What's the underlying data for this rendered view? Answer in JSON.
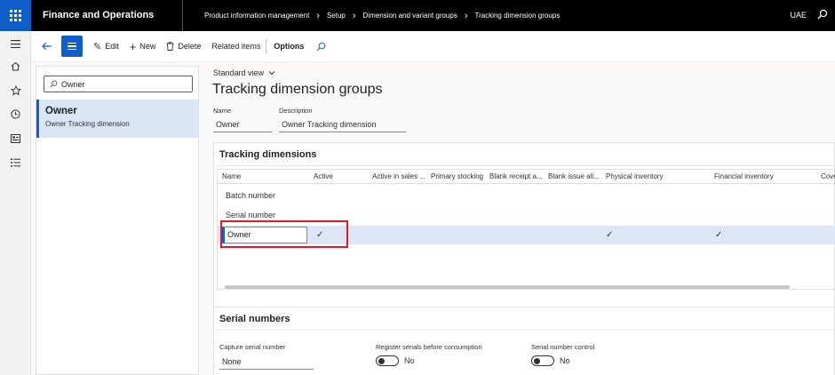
{
  "topbar": {
    "app_title": "Finance and Operations",
    "breadcrumbs": [
      "Product information management",
      "Setup",
      "Dimension and variant groups",
      "Tracking dimension groups"
    ],
    "company": "UAE"
  },
  "rail": {
    "icons": [
      "hamburger-icon",
      "home-icon",
      "star-icon",
      "clock-icon",
      "workspace-icon",
      "list-icon"
    ]
  },
  "actionbar": {
    "edit_label": "Edit",
    "new_label": "New",
    "delete_label": "Delete",
    "related_label": "Related items",
    "options_label": "Options"
  },
  "listpanel": {
    "filter_value": "Owner",
    "items": [
      {
        "title": "Owner",
        "subtitle": "Owner Tracking dimension"
      }
    ]
  },
  "main": {
    "view_label": "Standard view",
    "page_title": "Tracking dimension groups",
    "name_label": "Name",
    "name_value": "Owner",
    "description_label": "Description",
    "description_value": "Owner Tracking dimension"
  },
  "tracking": {
    "section_title": "Tracking dimensions",
    "columns": [
      "Name",
      "Active",
      "Active in sales ...",
      "Primary stocking",
      "Blank receipt a...",
      "Blank issue all...",
      "Physical inventory",
      "Financial inventory",
      "Cove"
    ],
    "rows": [
      {
        "name": "Batch number",
        "active": false,
        "physical": false,
        "financial": false
      },
      {
        "name": "Serial number",
        "active": false,
        "physical": false,
        "financial": false
      },
      {
        "name": "Owner",
        "active": true,
        "physical": true,
        "financial": true
      }
    ],
    "check_glyph": "✓"
  },
  "serial": {
    "section_title": "Serial numbers",
    "capture_label": "Capture serial number",
    "capture_value": "None",
    "register_label": "Register serials before consumption",
    "register_value": "No",
    "control_label": "Serial number control",
    "control_value": "No"
  }
}
